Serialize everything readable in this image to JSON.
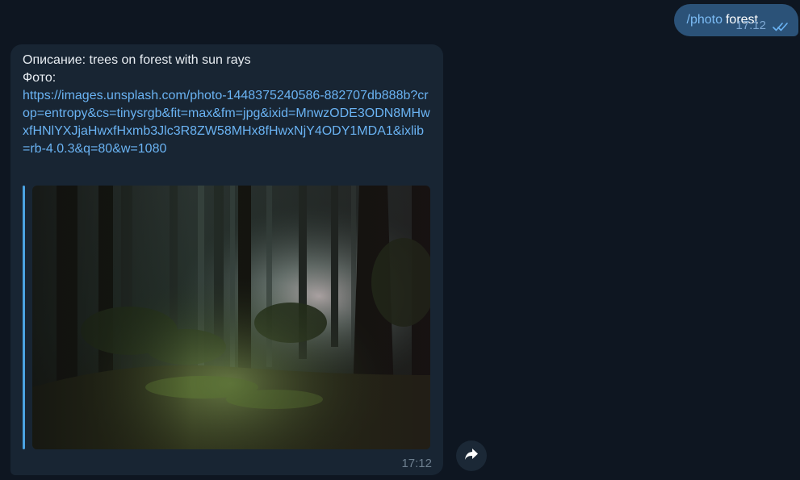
{
  "outgoing": {
    "command": "/photo",
    "text": "forest",
    "time": "17:12",
    "status_icon": "double-check-icon"
  },
  "incoming": {
    "description_line": "Описание: trees on forest with sun rays",
    "photo_label": "Фото:",
    "link": "https://images.unsplash.com/photo-1448375240586-882707db888b?crop=entropy&cs=tinysrgb&fit=max&fm=jpg&ixid=MnwzODE3ODN8MHwxfHNlYXJjaHwxfHxmb3Jlc3R8ZW58MHx8fHwxNjY4ODY1MDA1&ixlib=rb-4.0.3&q=80&w=1080",
    "time": "17:12",
    "preview_image_alt": "trees on forest with sun rays"
  },
  "actions": {
    "share_icon": "share-arrow-icon"
  },
  "colors": {
    "background": "#0e1621",
    "outgoing_bubble": "#2b5278",
    "incoming_bubble": "#182533",
    "link": "#6ab3f3",
    "accent_bar": "#4ba3e2"
  }
}
